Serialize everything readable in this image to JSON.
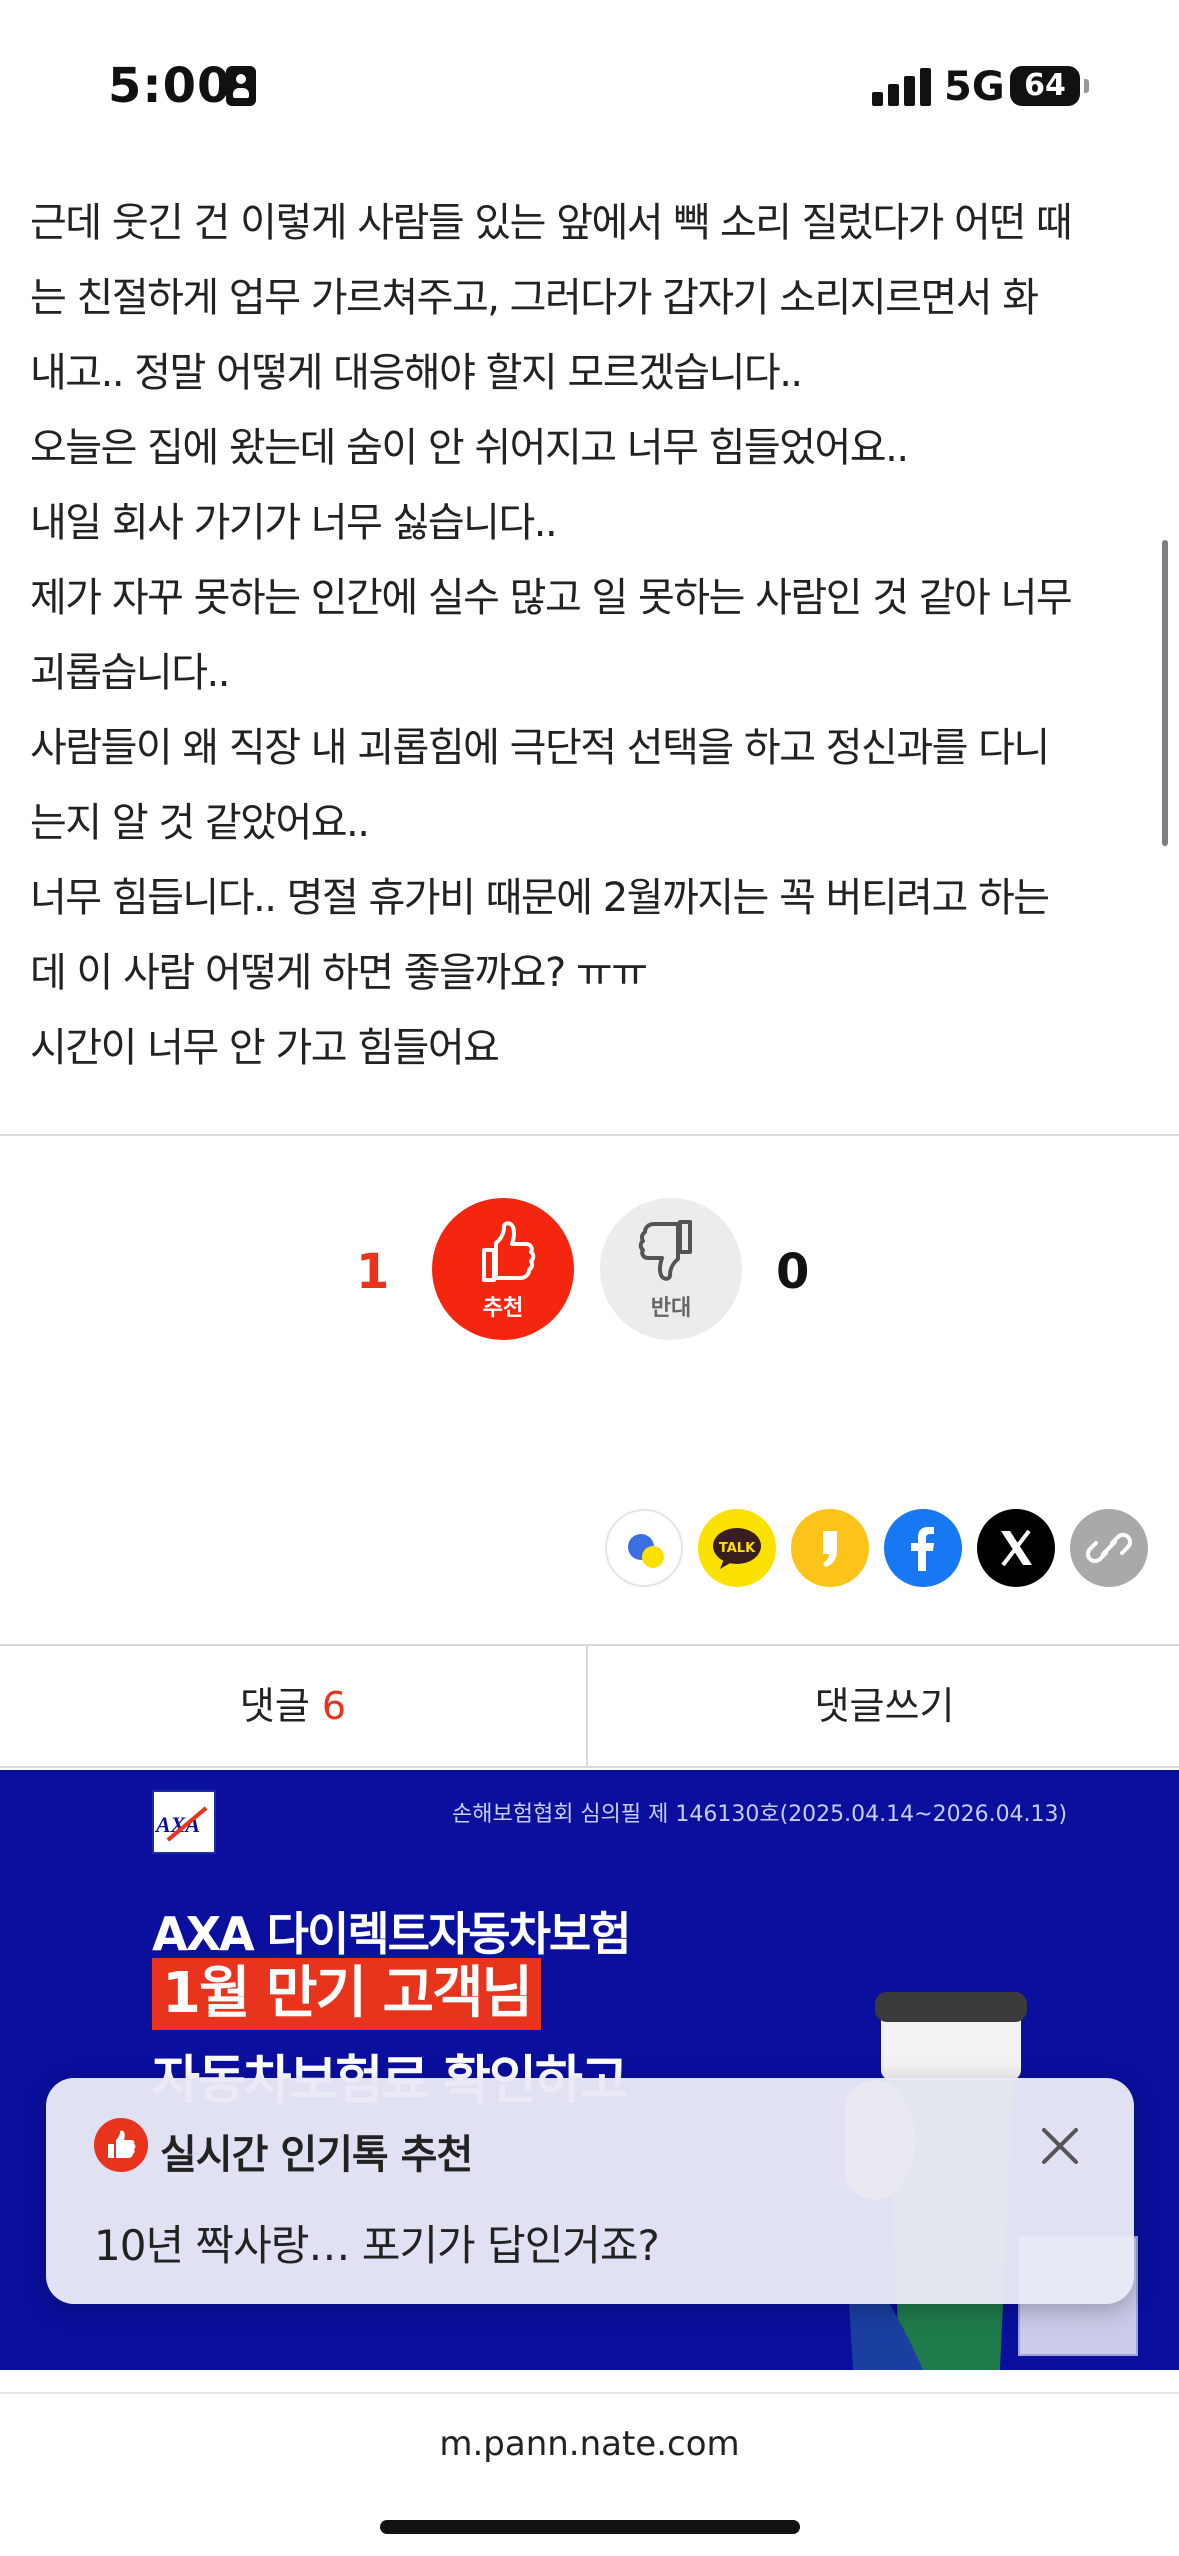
{
  "status_bar": {
    "time": "5:00",
    "network": "5G",
    "battery": "64"
  },
  "article": {
    "paragraphs": [
      "근데 웃긴 건 이렇게 사람들 있는 앞에서 빽 소리 질렀다가 어떤 때\n는 친절하게 업무 가르쳐주고, 그러다가 갑자기 소리지르면서 화\n내고.. 정말 어떻게 대응해야 할지 모르겠습니다..",
      "오늘은 집에 왔는데 숨이 안 쉬어지고 너무 힘들었어요..",
      "내일 회사 가기가 너무 싫습니다..",
      "제가 자꾸 못하는 인간에 실수 많고 일 못하는 사람인 것 같아 너무\n괴롭습니다..",
      "사람들이 왜 직장 내 괴롭힘에 극단적 선택을 하고 정신과를 다니\n는지 알 것 같았어요..",
      "너무 힘듭니다.. 명절 휴가비 때문에 2월까지는 꼭 버티려고 하는\n데 이 사람 어떻게 하면 좋을까요? ㅠㅠ",
      "시간이 너무 안 가고 힘들어요"
    ]
  },
  "votes": {
    "up_count": "1",
    "up_label": "추천",
    "down_count": "0",
    "down_label": "반대"
  },
  "share": {
    "icons": [
      "kakaostory-icon",
      "kakaotalk-icon",
      "kakao-channel-icon",
      "facebook-icon",
      "x-icon",
      "link-icon"
    ],
    "talk_label": "TALK"
  },
  "comment_tabs": {
    "comments_label": "댓글",
    "comments_count": "6",
    "write_label": "댓글쓰기"
  },
  "ad": {
    "brand": "AXA",
    "cert": "손해보험협회 심의필 제 146130호(2025.04.14~2026.04.13)",
    "line1": "AXA 다이렉트자동차보험",
    "line2": "1월 만기 고객님",
    "line3": "자동차보험료 확인하고"
  },
  "toast": {
    "title": "실시간 인기톡 추천",
    "body": "10년 짝사랑… 포기가 답인거죠?"
  },
  "browser": {
    "url": "m.pann.nate.com"
  },
  "colors": {
    "accent_red": "#e8331d",
    "ad_blue": "#0a0f9e",
    "kakao_yellow": "#fae100",
    "facebook_blue": "#1877f2"
  }
}
